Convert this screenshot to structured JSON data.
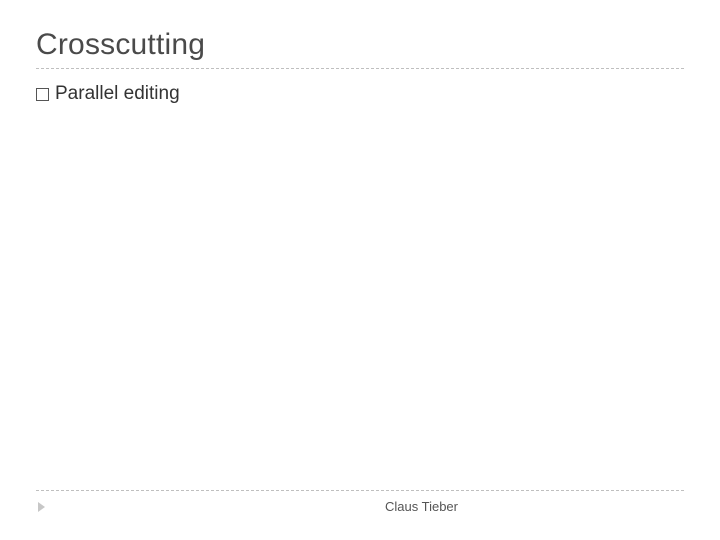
{
  "slide": {
    "title": "Crosscutting",
    "bullets": [
      {
        "text": "Parallel editing"
      }
    ],
    "footer": {
      "author": "Claus Tieber"
    }
  }
}
